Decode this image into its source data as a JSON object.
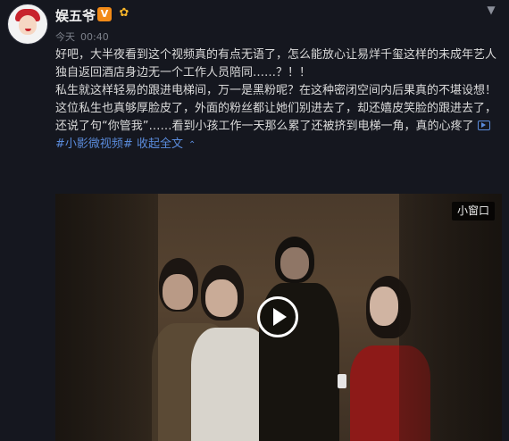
{
  "post": {
    "author": "娱五爷",
    "vip_badge": "V",
    "time_day": "今天",
    "time_clock": "00:40",
    "paragraphs": [
      "好吧，大半夜看到这个视频真的有点无语了，怎么能放心让易烊千玺这样的未成年艺人独自返回酒店身边无一个工作人员陪同……？！！",
      "私生就这样轻易的跟进电梯间，万一是黑粉呢？在这种密闭空间内后果真的不堪设想！",
      "这位私生也真够厚脸皮了，外面的粉丝都让她们别进去了，却还嬉皮笑脸的跟进去了，还说了句“你管我”……看到小孩工作一天那么累了还被挤到电梯一角，真的心疼了"
    ],
    "topic_link": "#小影微视频#",
    "collapse_label": "收起全文",
    "collapse_chevron": "⌃"
  },
  "video": {
    "small_window_label": "小窗口"
  },
  "icons": {
    "menu": "chevron-down-icon",
    "video_link": "video-icon",
    "play": "play-icon"
  },
  "colors": {
    "background": "#15171f",
    "link": "#5a8bdb",
    "vip": "#f28a17"
  }
}
